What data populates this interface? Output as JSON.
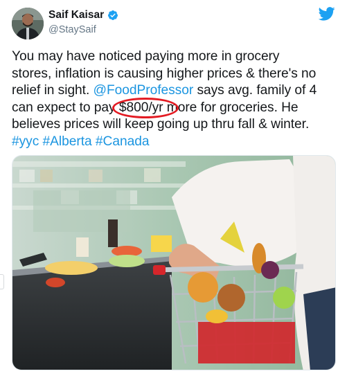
{
  "user": {
    "display_name": "Saif Kaisar",
    "handle": "@StaySaif",
    "verified": true,
    "avatar_icon": "user-avatar-photo"
  },
  "brand": {
    "icon": "twitter-bird-icon",
    "color": "#1da1f2"
  },
  "tweet": {
    "line1": "You may have noticed paying more in grocery",
    "line2": "stores, inflation is causing higher prices & there's no",
    "line3_pre": "relief in sight.",
    "mention": "@FoodProfessor",
    "line3_post": "says avg. family of 4",
    "line4_pre": "can expect to pay",
    "highlight": "$800/yr",
    "line4_post": "more for groceries. He",
    "line5": "believes prices will keep going up thru fall & winter.",
    "hashtags": [
      "#yyc",
      "#Alberta",
      "#Canada"
    ]
  },
  "annotation": {
    "shape": "ellipse",
    "color": "#e31b23"
  },
  "colors": {
    "link": "#1b95e0",
    "text": "#14171a",
    "secondary": "#657786"
  },
  "media": {
    "icon": "grocery-cart-photo"
  }
}
